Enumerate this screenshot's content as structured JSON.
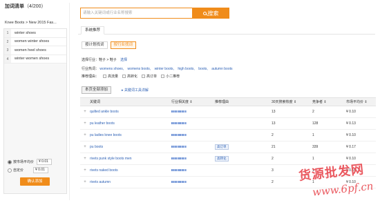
{
  "left_panel": {
    "title": "加词清单",
    "count_label": "（4/200）",
    "category_path": "Knee Boots > New 2015 Fas...",
    "keywords": [
      {
        "num": "1",
        "text": "winter shoes"
      },
      {
        "num": "2",
        "text": "women winter shoes"
      },
      {
        "num": "3",
        "text": "women heel shoes"
      },
      {
        "num": "4",
        "text": "winter women shoes"
      }
    ],
    "bid_options": [
      {
        "label": "按市场平均价",
        "value": "¥ 0.01",
        "checked": true
      },
      {
        "label": "自定价",
        "value": "¥ 0.01",
        "checked": false
      }
    ],
    "confirm_label": "确认添加"
  },
  "search": {
    "placeholder": "请输入关键词或行业名称搜索",
    "button_label": "搜索"
  },
  "main_tab": "系统推荐",
  "subtabs": [
    {
      "label": "按计划找词",
      "active": false
    },
    {
      "label": "按行业找词",
      "active": true
    }
  ],
  "industry": {
    "prefix": "选择行业：鞋子 > 鞋子",
    "link": "选择"
  },
  "hot": {
    "prefix": "行业热词：",
    "words": [
      "womens shoes,",
      "womens boots,",
      "winter boots,",
      "high boots,",
      "boots,",
      "autumn boots"
    ]
  },
  "reasons": {
    "prefix": "推荐理由：",
    "options": [
      "高流量",
      "高转化",
      "高订单",
      "小二推荐"
    ]
  },
  "add_all_label": "本页全部添加",
  "tool_link": "关键词工具详解",
  "table": {
    "headers": [
      "",
      "关键词",
      "行业相关度 ⇕",
      "推荐理由",
      "30天搜索热度 ⇕",
      "竞争者 ⇕",
      "市场平均价 ⇕"
    ],
    "rows": [
      {
        "keyword": "quilted ankle boots",
        "reason": "",
        "heat": "13",
        "competitors": "2",
        "price": "¥ 0.10"
      },
      {
        "keyword": "pu leather boots",
        "reason": "",
        "heat": "13",
        "competitors": "128",
        "price": "¥ 0.13"
      },
      {
        "keyword": "pu ladies knee boots",
        "reason": "",
        "heat": "2",
        "competitors": "1",
        "price": "¥ 0.10"
      },
      {
        "keyword": "pu boots",
        "reason": "高订单",
        "heat": "21",
        "competitors": "339",
        "price": "¥ 0.17"
      },
      {
        "keyword": "rivets punk style boots men",
        "reason": "高转化",
        "heat": "2",
        "competitors": "1",
        "price": "¥ 0.10"
      },
      {
        "keyword": "rivets naked boots",
        "reason": "",
        "heat": "3",
        "competitors": "1",
        "price": "¥ 0.10"
      },
      {
        "keyword": "rivets autumn",
        "reason": "",
        "heat": "2",
        "competitors": "1",
        "price": "¥ 0.10"
      }
    ]
  },
  "watermark": {
    "text": "货源批发网",
    "url": "www.6pf.cn"
  },
  "colors": {
    "accent": "#f08c1a",
    "link": "#2b5fb4",
    "relevance_bar": "#5b84d1",
    "watermark": "#e8484f"
  }
}
